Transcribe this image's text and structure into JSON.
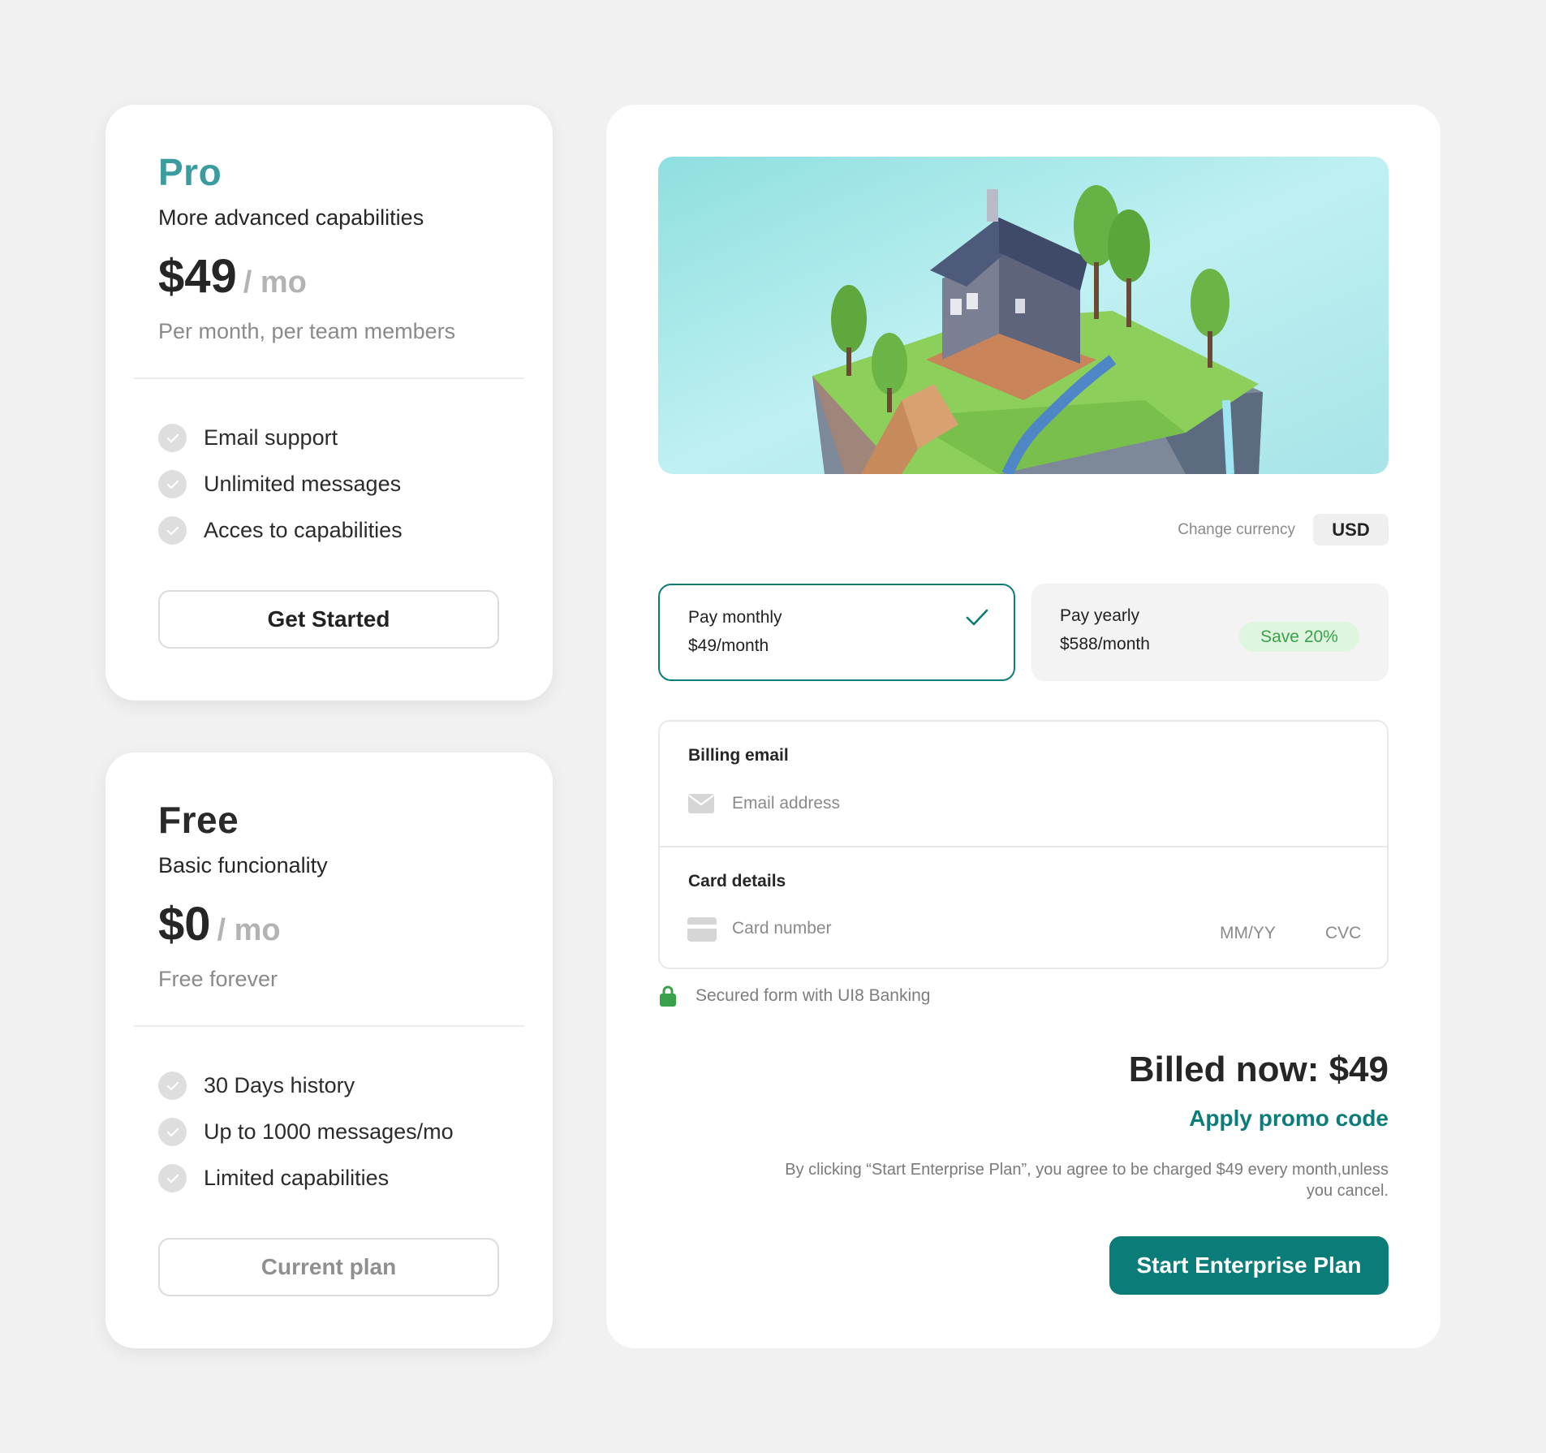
{
  "colors": {
    "accent": "#0b7d78",
    "pro_title": "#3a9c9e",
    "save_badge_bg": "#dff5df",
    "save_badge_text": "#3aa14a",
    "lock_green": "#3aa14a"
  },
  "plans": [
    {
      "name": "Pro",
      "tagline": "More advanced capabilities",
      "price": "$49",
      "period": "/ mo",
      "note": "Per month, per team members",
      "features": [
        "Email support",
        "Unlimited messages",
        "Acces to capabilities"
      ],
      "button": "Get Started"
    },
    {
      "name": "Free",
      "tagline": "Basic funcionality",
      "price": "$0",
      "period": "/ mo",
      "note": "Free forever",
      "features": [
        "30 Days history",
        "Up to 1000 messages/mo",
        "Limited capabilities"
      ],
      "button": "Current plan"
    }
  ],
  "checkout": {
    "hero_image": "isometric-house-on-floating-island",
    "currency_label": "Change currency",
    "currency_value": "USD",
    "monthly": {
      "title": "Pay monthly",
      "amount": "$49/month",
      "selected": true,
      "icon": "checkmark-icon"
    },
    "yearly": {
      "title": "Pay yearly",
      "amount": "$588/month",
      "badge": "Save 20%"
    },
    "email_label": "Billing email",
    "email_placeholder": "Email address",
    "email_icon": "envelope-icon",
    "card_label": "Card details",
    "card_placeholder": "Card number",
    "card_icon": "credit-card-icon",
    "expiry_placeholder": "MM/YY",
    "cvc_placeholder": "CVC",
    "secure_icon": "lock-icon",
    "secure_text": "Secured form with UI8 Banking",
    "billed_now": "Billed now: $49",
    "promo": "Apply promo code",
    "terms": "By clicking “Start Enterprise Plan”, you agree to be charged $49 every month,unless you cancel.",
    "submit": "Start Enterprise Plan"
  }
}
